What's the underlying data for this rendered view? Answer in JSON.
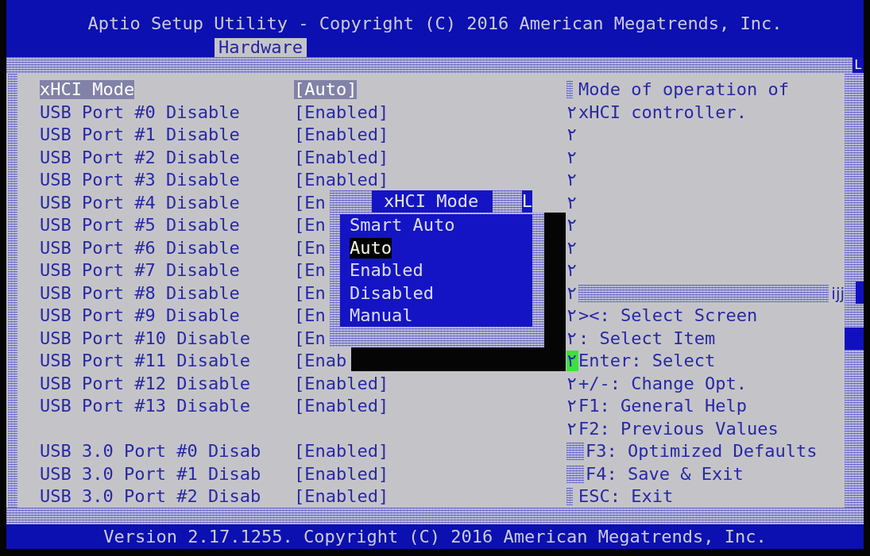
{
  "header": {
    "title": "Aptio Setup Utility - Copyright (C) 2016 American Megatrends, Inc.",
    "tabs": [
      {
        "label": "Hardware",
        "selected": true
      }
    ]
  },
  "frame": {
    "corner_mark": "L"
  },
  "setting_groups": [
    [
      {
        "label": "xHCI Mode",
        "value": "[Auto]",
        "selected": true
      },
      {
        "label": "USB Port #0 Disable",
        "value": "[Enabled]",
        "selected": false
      },
      {
        "label": "USB Port #1 Disable",
        "value": "[Enabled]",
        "selected": false
      },
      {
        "label": "USB Port #2 Disable",
        "value": "[Enabled]",
        "selected": false
      },
      {
        "label": "USB Port #3 Disable",
        "value": "[Enabled]",
        "selected": false
      },
      {
        "label": "USB Port #4 Disable",
        "value": "[En",
        "selected": false
      },
      {
        "label": "USB Port #5 Disable",
        "value": "[En",
        "selected": false
      },
      {
        "label": "USB Port #6 Disable",
        "value": "[En",
        "selected": false
      },
      {
        "label": "USB Port #7 Disable",
        "value": "[En",
        "selected": false
      },
      {
        "label": "USB Port #8 Disable",
        "value": "[En",
        "selected": false
      },
      {
        "label": "USB Port #9 Disable",
        "value": "[En",
        "selected": false
      },
      {
        "label": "USB Port #10 Disable",
        "value": "[En",
        "selected": false
      },
      {
        "label": "USB Port #11 Disable",
        "value": "[Enab",
        "selected": false
      },
      {
        "label": "USB Port #12 Disable",
        "value": "[Enabled]",
        "selected": false
      },
      {
        "label": "USB Port #13 Disable",
        "value": "[Enabled]",
        "selected": false
      }
    ],
    [
      {
        "label": "USB 3.0 Port #0 Disab",
        "value": "[Enabled]",
        "selected": false
      },
      {
        "label": "USB 3.0 Port #1 Disab",
        "value": "[Enabled]",
        "selected": false
      },
      {
        "label": "USB 3.0 Port #2 Disab",
        "value": "[Enabled]",
        "selected": false
      }
    ]
  ],
  "popup": {
    "title": "xHCI Mode",
    "corner_mark": "L",
    "options": [
      {
        "label": "Smart Auto",
        "selected": false
      },
      {
        "label": "Auto",
        "selected": true
      },
      {
        "label": "Enabled",
        "selected": false
      },
      {
        "label": "Disabled",
        "selected": false
      },
      {
        "label": "Manual",
        "selected": false
      }
    ]
  },
  "help": {
    "description": [
      {
        "kind": "hatch",
        "text": "Mode of operation of",
        "cursor": false
      },
      {
        "kind": "glyph",
        "mark": "٢",
        "text": "xHCI controller.",
        "cursor": false
      },
      {
        "kind": "glyph",
        "mark": "٢",
        "cursor": false
      },
      {
        "kind": "glyph",
        "mark": "٢",
        "cursor": false
      },
      {
        "kind": "glyph",
        "mark": "٢",
        "cursor": false
      },
      {
        "kind": "glyph",
        "mark": "٢",
        "cursor": false
      },
      {
        "kind": "glyph",
        "mark": "٢",
        "cursor": false
      },
      {
        "kind": "glyph",
        "mark": "٢",
        "cursor": false
      },
      {
        "kind": "glyph",
        "mark": "٢",
        "cursor": false
      },
      {
        "kind": "separator",
        "mark": "٢",
        "text": "ijj",
        "cursor": false
      }
    ],
    "keys": [
      {
        "kind": "glyph",
        "mark": "٢",
        "text": "><: Select Screen",
        "cursor": false
      },
      {
        "kind": "glyph",
        "mark": "٢",
        "text": ": Select Item",
        "cursor": false
      },
      {
        "kind": "glyph",
        "mark": "٢",
        "text": "Enter: Select",
        "cursor": true
      },
      {
        "kind": "glyph",
        "mark": "٢",
        "text": "+/-: Change Opt.",
        "cursor": false
      },
      {
        "kind": "glyph",
        "mark": "٢",
        "text": "F1: General Help",
        "cursor": false
      },
      {
        "kind": "glyph",
        "mark": "٢",
        "text": "F2: Previous Values",
        "cursor": false
      },
      {
        "kind": "hatch_wide",
        "text": "F3: Optimized Defaults",
        "cursor": false
      },
      {
        "kind": "hatch_wide",
        "text": "F4: Save & Exit",
        "cursor": false
      },
      {
        "kind": "hatch",
        "text": "ESC: Exit",
        "cursor": false
      }
    ]
  },
  "footer": {
    "text": "Version 2.17.1255. Copyright (C) 2016 American Megatrends, Inc."
  }
}
